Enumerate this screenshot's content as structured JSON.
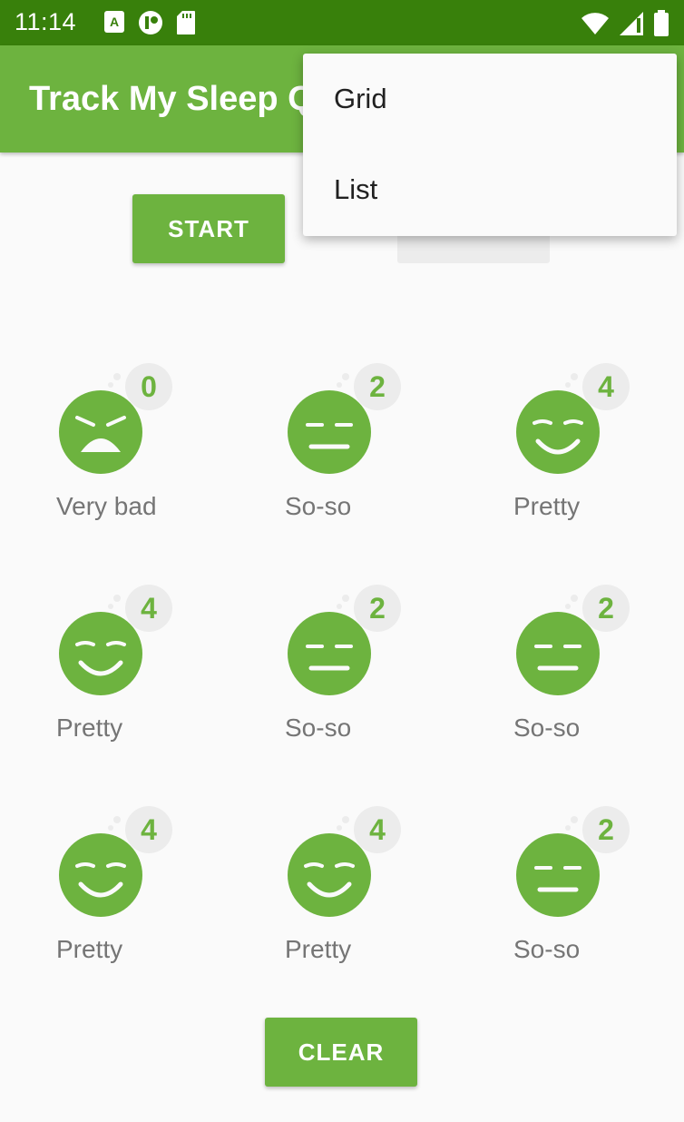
{
  "status_bar": {
    "time": "11:14",
    "left_icons": [
      "a-icon",
      "play-circle-icon",
      "sd-card-icon"
    ],
    "right_icons": [
      "wifi-icon",
      "signal-icon",
      "battery-icon"
    ]
  },
  "app_bar": {
    "title": "Track My Sleep Quality"
  },
  "buttons": {
    "start": "START",
    "clear": "CLEAR"
  },
  "nights": [
    {
      "label": "Very bad",
      "score": "0",
      "face": "very-bad"
    },
    {
      "label": "So-so",
      "score": "2",
      "face": "so-so"
    },
    {
      "label": "Pretty",
      "score": "4",
      "face": "pretty"
    },
    {
      "label": "Pretty",
      "score": "4",
      "face": "pretty"
    },
    {
      "label": "So-so",
      "score": "2",
      "face": "so-so"
    },
    {
      "label": "So-so",
      "score": "2",
      "face": "so-so"
    },
    {
      "label": "Pretty",
      "score": "4",
      "face": "pretty"
    },
    {
      "label": "Pretty",
      "score": "4",
      "face": "pretty"
    },
    {
      "label": "So-so",
      "score": "2",
      "face": "so-so"
    }
  ],
  "overflow_menu": {
    "items": [
      {
        "label": "Grid"
      },
      {
        "label": "List"
      }
    ]
  },
  "colors": {
    "status_bar": "#38800b",
    "primary": "#6db33f",
    "background": "#fafafa",
    "badge_bg": "#ececec",
    "label_text": "#757575"
  }
}
